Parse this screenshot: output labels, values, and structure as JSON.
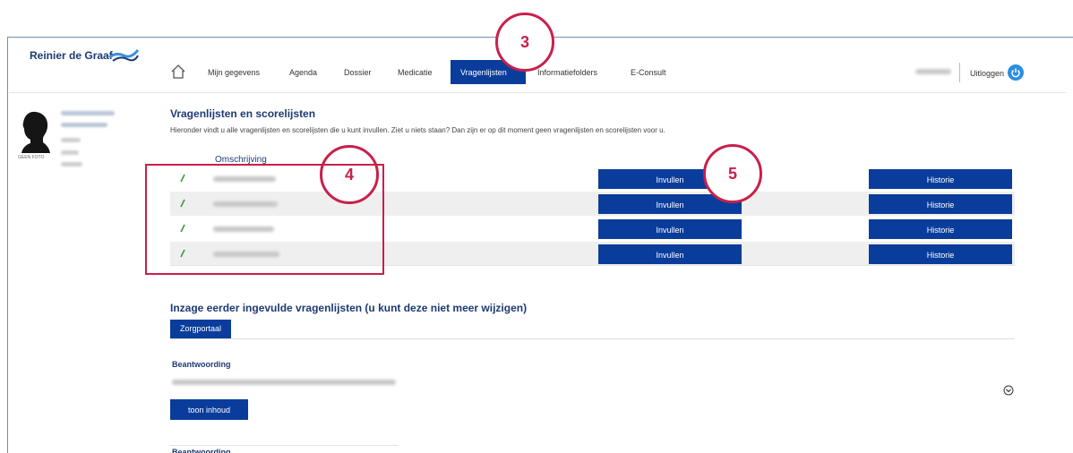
{
  "header": {
    "logo_text": "Reinier de Graaf",
    "nav": [
      "Mijn gegevens",
      "Agenda",
      "Dossier",
      "Medicatie",
      "Vragenlijsten",
      "Informatiefolders",
      "E-Consult"
    ],
    "active_nav": "Vragenlijsten",
    "logout_label": "Uitloggen"
  },
  "sidebar": {
    "photo_caption": "GEEN FOTO"
  },
  "main": {
    "title": "Vragenlijsten en scorelijsten",
    "intro": "Hieronder vindt u alle vragenlijsten en scorelijsten die u kunt invullen. Ziet u niets staan? Dan zijn er op dit moment geen vragenlijsten en scorelijsten voor u.",
    "column_header": "Omschrijving",
    "rows": [
      {
        "fill_label": "Invullen",
        "history_label": "Historie"
      },
      {
        "fill_label": "Invullen",
        "history_label": "Historie"
      },
      {
        "fill_label": "Invullen",
        "history_label": "Historie"
      },
      {
        "fill_label": "Invullen",
        "history_label": "Historie"
      }
    ]
  },
  "history_section": {
    "title": "Inzage eerder ingevulde vragenlijsten (u kunt deze niet meer wijzigen)",
    "tab_label": "Zorgportaal",
    "answer_label": "Beantwoording",
    "show_button": "toon inhoud",
    "answer_label_2": "Beantwoording"
  },
  "annotations": {
    "callout_3": "3",
    "callout_4": "4",
    "callout_5": "5",
    "color": "#c9204a"
  },
  "colors": {
    "accent": "#0a3d9b",
    "heading": "#1d3a73"
  }
}
